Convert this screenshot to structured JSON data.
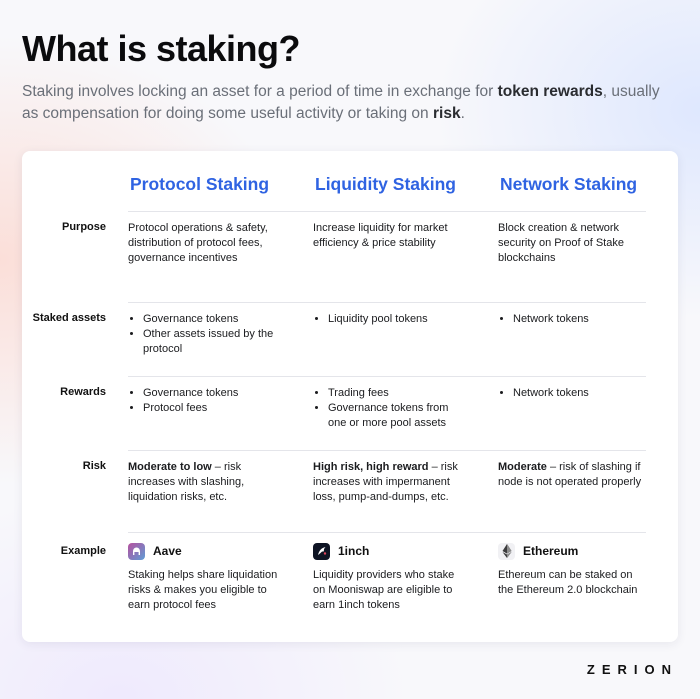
{
  "title": "What is staking?",
  "subtitle": {
    "part1": "Staking involves locking an asset for a period of time in exchange for ",
    "bold1": "token rewards",
    "part2": ", usually as compensation for doing some useful activity or taking on ",
    "bold2": "risk",
    "part3": "."
  },
  "columns": [
    "Protocol Staking",
    "Liquidity Staking",
    "Network Staking"
  ],
  "rows": {
    "purpose": {
      "label": "Purpose",
      "protocol": "Protocol operations & safety, distribution of protocol fees, governance incentives",
      "liquidity": "Increase liquidity for market efficiency & price stability",
      "network": "Block creation & network security on Proof of Stake blockchains"
    },
    "staked_assets": {
      "label": "Staked assets",
      "protocol": [
        "Governance tokens",
        "Other assets issued by the protocol"
      ],
      "liquidity": [
        "Liquidity pool tokens"
      ],
      "network": [
        "Network tokens"
      ]
    },
    "rewards": {
      "label": "Rewards",
      "protocol": [
        "Governance tokens",
        "Protocol fees"
      ],
      "liquidity": [
        "Trading fees",
        "Governance tokens from one or more pool assets"
      ],
      "network": [
        "Network tokens"
      ]
    },
    "risk": {
      "label": "Risk",
      "protocol": {
        "bold": "Moderate to low",
        "text": " – risk increases with slashing, liquidation risks, etc."
      },
      "liquidity": {
        "bold": "High risk, high reward",
        "text": " – risk increases with impermanent loss, pump-and-dumps, etc."
      },
      "network": {
        "bold": "Moderate",
        "text": " – risk of slashing if node is not operated properly"
      }
    },
    "example": {
      "label": "Example",
      "protocol": {
        "name": "Aave",
        "icon": "aave-logo-icon",
        "text": "Staking helps share liquidation risks & makes you eligible to earn protocol fees"
      },
      "liquidity": {
        "name": "1inch",
        "icon": "1inch-logo-icon",
        "text": "Liquidity providers who stake on Mooniswap are eligible to earn 1inch tokens"
      },
      "network": {
        "name": "Ethereum",
        "icon": "ethereum-logo-icon",
        "text": "Ethereum can be staked on the Ethereum 2.0 blockchain"
      }
    }
  },
  "brand": "ZERION",
  "colors": {
    "accent": "#2f63e2",
    "text": "#111111",
    "muted": "#6a6f78"
  }
}
